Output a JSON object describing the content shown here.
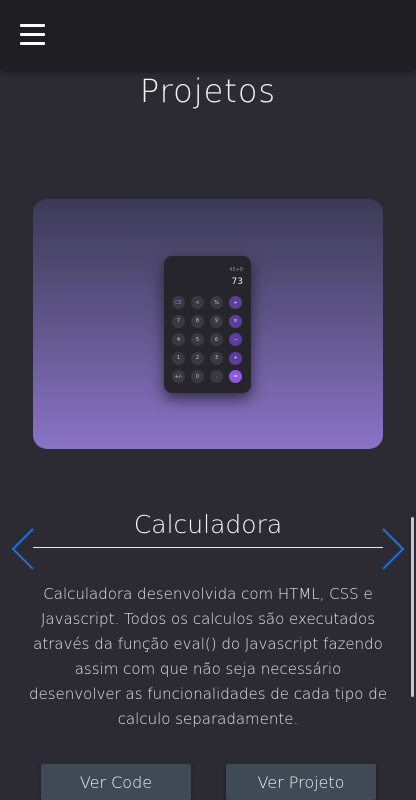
{
  "header": {
    "menu_icon": "hamburger-icon"
  },
  "page": {
    "title": "Projetos"
  },
  "project": {
    "name": "Calculadora",
    "description": "Calculadora desenvolvida com HTML, CSS e Javascript. Todos os calculos são executados através da função eval() do Javascript fazendo assim com que não seja necessário desenvolver as funcionalidades de cada tipo de calculo separadamente.",
    "preview": {
      "expression": "45+8",
      "result": "73",
      "keys": [
        [
          "CE",
          "<",
          "%",
          "÷"
        ],
        [
          "7",
          "8",
          "9",
          "×"
        ],
        [
          "4",
          "5",
          "6",
          "−"
        ],
        [
          "1",
          "2",
          "3",
          "+"
        ],
        [
          "+/-",
          "0",
          ".",
          "="
        ]
      ]
    }
  },
  "carousel": {
    "prev_icon": "chevron-left-icon",
    "next_icon": "chevron-right-icon"
  },
  "buttons": {
    "code": "Ver Code",
    "project": "Ver Projeto"
  },
  "colors": {
    "arrow": "#1f6fe0",
    "accent": "#8e58e2",
    "button_bg": "#3f4a55"
  }
}
